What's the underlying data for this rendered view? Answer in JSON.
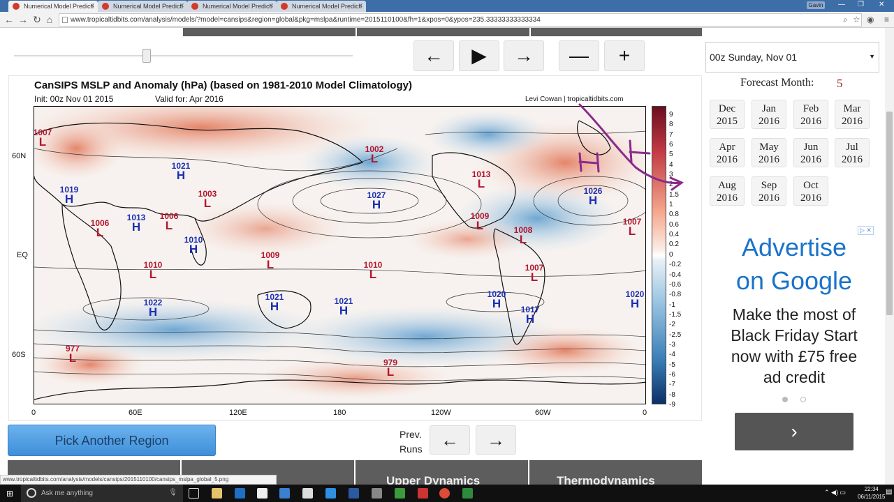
{
  "browser": {
    "tabs": [
      {
        "title": "Numerical Model Predicti"
      },
      {
        "title": "Numerical Model Predicti"
      },
      {
        "title": "Numerical Model Predicti"
      },
      {
        "title": "Numerical Model Predicti"
      }
    ],
    "user_badge": "Gavin",
    "url": "www.tropicaltidbits.com/analysis/models/?model=cansips&region=global&pkg=mslpa&runtime=2015110100&fh=1&xpos=0&ypos=235.33333333333334",
    "status_url": "www.tropicaltidbits.com/analysis/models/cansips/2015110100/cansips_mslpa_global_5.png"
  },
  "controls": {
    "back_arrow": "←",
    "play": "▶",
    "forward_arrow": "→",
    "minus": "—",
    "plus": "+"
  },
  "sidebar": {
    "date_select": "00z Sunday, Nov 01",
    "forecast_month_label": "Forecast Month:",
    "forecast_month_value": "5",
    "months": [
      {
        "month": "Dec",
        "year": "2015"
      },
      {
        "month": "Jan",
        "year": "2016"
      },
      {
        "month": "Feb",
        "year": "2016"
      },
      {
        "month": "Mar",
        "year": "2016"
      },
      {
        "month": "Apr",
        "year": "2016"
      },
      {
        "month": "May",
        "year": "2016"
      },
      {
        "month": "Jun",
        "year": "2016"
      },
      {
        "month": "Jul",
        "year": "2016"
      },
      {
        "month": "Aug",
        "year": "2016"
      },
      {
        "month": "Sep",
        "year": "2016"
      },
      {
        "month": "Oct",
        "year": "2016"
      }
    ]
  },
  "map": {
    "title": "CanSIPS MSLP and Anomaly (hPa) (based on 1981-2010 Model Climatology)",
    "init": "Init: 00z Nov 01 2015",
    "valid": "Valid for: Apr 2016",
    "credit": "Levi Cowan | tropicaltidbits.com",
    "lat_labels": [
      "60N",
      "EQ",
      "60S"
    ],
    "lon_labels": [
      "0",
      "60E",
      "120E",
      "180",
      "120W",
      "60W",
      "0"
    ],
    "colorbar_ticks": [
      "9",
      "8",
      "7",
      "6",
      "5",
      "4",
      "3",
      "2",
      "1.5",
      "1",
      "0.8",
      "0.6",
      "0.4",
      "0.2",
      "0",
      "-0.2",
      "-0.4",
      "-0.6",
      "-0.8",
      "-1",
      "-1.5",
      "-2",
      "-2.5",
      "-3",
      "-4",
      "-5",
      "-6",
      "-7",
      "-8",
      "-9"
    ],
    "pressure_centers": [
      {
        "type": "L",
        "value": "1007"
      },
      {
        "type": "H",
        "value": "1021"
      },
      {
        "type": "H",
        "value": "1019"
      },
      {
        "type": "L",
        "value": "1003"
      },
      {
        "type": "L",
        "value": "1006"
      },
      {
        "type": "H",
        "value": "1013"
      },
      {
        "type": "L",
        "value": "1006"
      },
      {
        "type": "H",
        "value": "1010"
      },
      {
        "type": "L",
        "value": "1002"
      },
      {
        "type": "H",
        "value": "1027"
      },
      {
        "type": "L",
        "value": "1013"
      },
      {
        "type": "L",
        "value": "1009"
      },
      {
        "type": "L",
        "value": "1009"
      },
      {
        "type": "L",
        "value": "1010"
      },
      {
        "type": "L",
        "value": "1010"
      },
      {
        "type": "H",
        "value": "1020"
      },
      {
        "type": "H",
        "value": "1021"
      },
      {
        "type": "H",
        "value": "1021"
      },
      {
        "type": "H",
        "value": "1020"
      },
      {
        "type": "H",
        "value": "1017"
      },
      {
        "type": "L",
        "value": "1008"
      },
      {
        "type": "L",
        "value": "1007"
      },
      {
        "type": "H",
        "value": "1026"
      },
      {
        "type": "L",
        "value": "1007"
      },
      {
        "type": "H",
        "value": "1022"
      },
      {
        "type": "L",
        "value": "977"
      },
      {
        "type": "L",
        "value": "979"
      }
    ]
  },
  "bottom": {
    "pick_region": "Pick Another Region",
    "prev_runs": "Prev. Runs",
    "nav_items": [
      "Upper Dynamics",
      "Thermodynamics"
    ]
  },
  "ad": {
    "headline_1": "Advertise",
    "headline_2": "on Google",
    "body": [
      "Make the most of",
      "Black Friday Start",
      "now with £75 free",
      "ad credit"
    ],
    "arrow": "›"
  },
  "taskbar": {
    "search_placeholder": "Ask me anything",
    "time": "22:34",
    "date": "06/11/2015"
  }
}
